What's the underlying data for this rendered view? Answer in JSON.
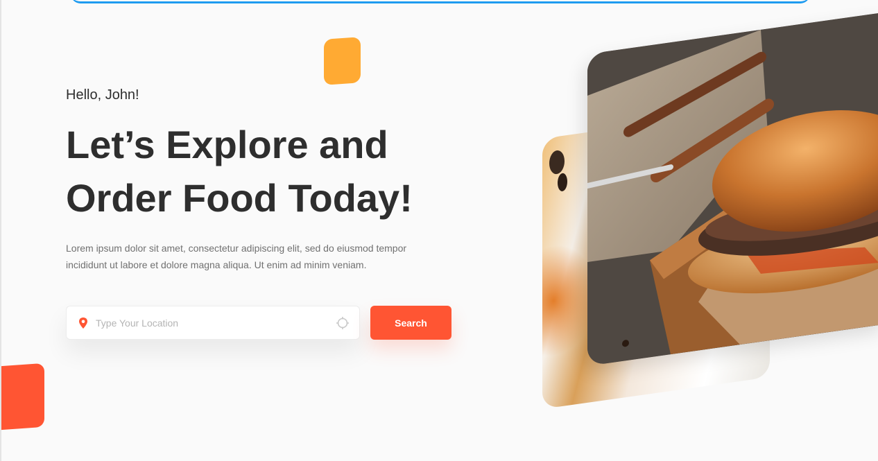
{
  "hero": {
    "greeting": "Hello, John!",
    "headline_line1": "Let’s Explore and",
    "headline_line2": "Order Food Today!",
    "intro": "Lorem ipsum dolor sit amet, consectetur adipiscing elit, sed do eiusmod tempor incididunt ut labore et dolore magna aliqua. Ut enim ad minim veniam."
  },
  "search": {
    "placeholder": "Type Your Location",
    "value": "",
    "button_label": "Search",
    "leading_icon": "location-pin-icon",
    "trailing_icon": "crosshair-icon"
  },
  "colors": {
    "accent": "#ff5533",
    "decoration_yellow": "#ffaa33",
    "top_line": "#1e9bf0",
    "heading_text": "#2e2e2e",
    "body_text": "#707070"
  },
  "images": {
    "front": "burger-photo",
    "back": "food-plate-photo"
  }
}
